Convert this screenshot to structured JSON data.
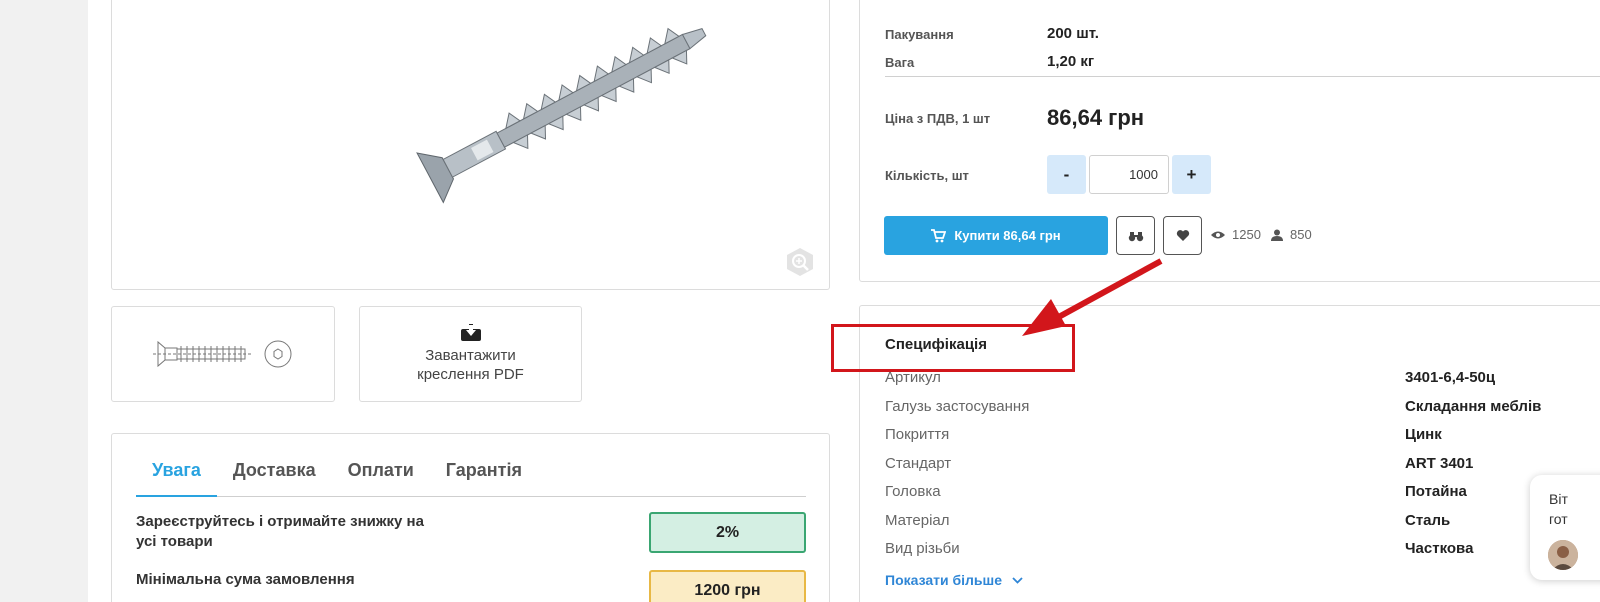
{
  "product": {
    "packaging_label": "Пакування",
    "packaging_value": "200 шт.",
    "weight_label": "Вага",
    "weight_value": "1,20 кг",
    "price_label": "Ціна з ПДВ, 1 шт",
    "price_value": "86,64 грн",
    "qty_label": "Кількість, шт",
    "qty_minus": "-",
    "qty_value": "1000",
    "qty_plus": "+",
    "buy_label": "Купити 86,64 грн",
    "views": "1250",
    "buyers": "850"
  },
  "media": {
    "pdf_label": "Завантажити креслення PDF"
  },
  "tabs": [
    {
      "label": "Увага"
    },
    {
      "label": "Доставка"
    },
    {
      "label": "Оплати"
    },
    {
      "label": "Гарантія"
    }
  ],
  "promos": [
    {
      "text": "Зареєструйтесь і отримайте знижку на усі товари",
      "badge": "2%"
    },
    {
      "text": "Мінімальна сума замовлення",
      "badge": "1200 грн"
    }
  ],
  "spec": {
    "title": "Специфікація",
    "rows": [
      {
        "label": "Артикул",
        "value": "3401-6,4-50ц"
      },
      {
        "label": "Галузь застосування",
        "value": "Складання меблів"
      },
      {
        "label": "Покриття",
        "value": "Цинк"
      },
      {
        "label": "Стандарт",
        "value": "ART 3401"
      },
      {
        "label": "Головка",
        "value": "Потайна"
      },
      {
        "label": "Матеріал",
        "value": "Сталь"
      },
      {
        "label": "Вид різьби",
        "value": "Часткова"
      }
    ],
    "show_more": "Показати більше"
  },
  "chat": {
    "line1": "Віт",
    "line2": "гот"
  },
  "colors": {
    "accent": "#29a3e0",
    "highlight": "#d2161b",
    "badge_green": "#d4efe3",
    "badge_yellow": "#fbecc5"
  }
}
